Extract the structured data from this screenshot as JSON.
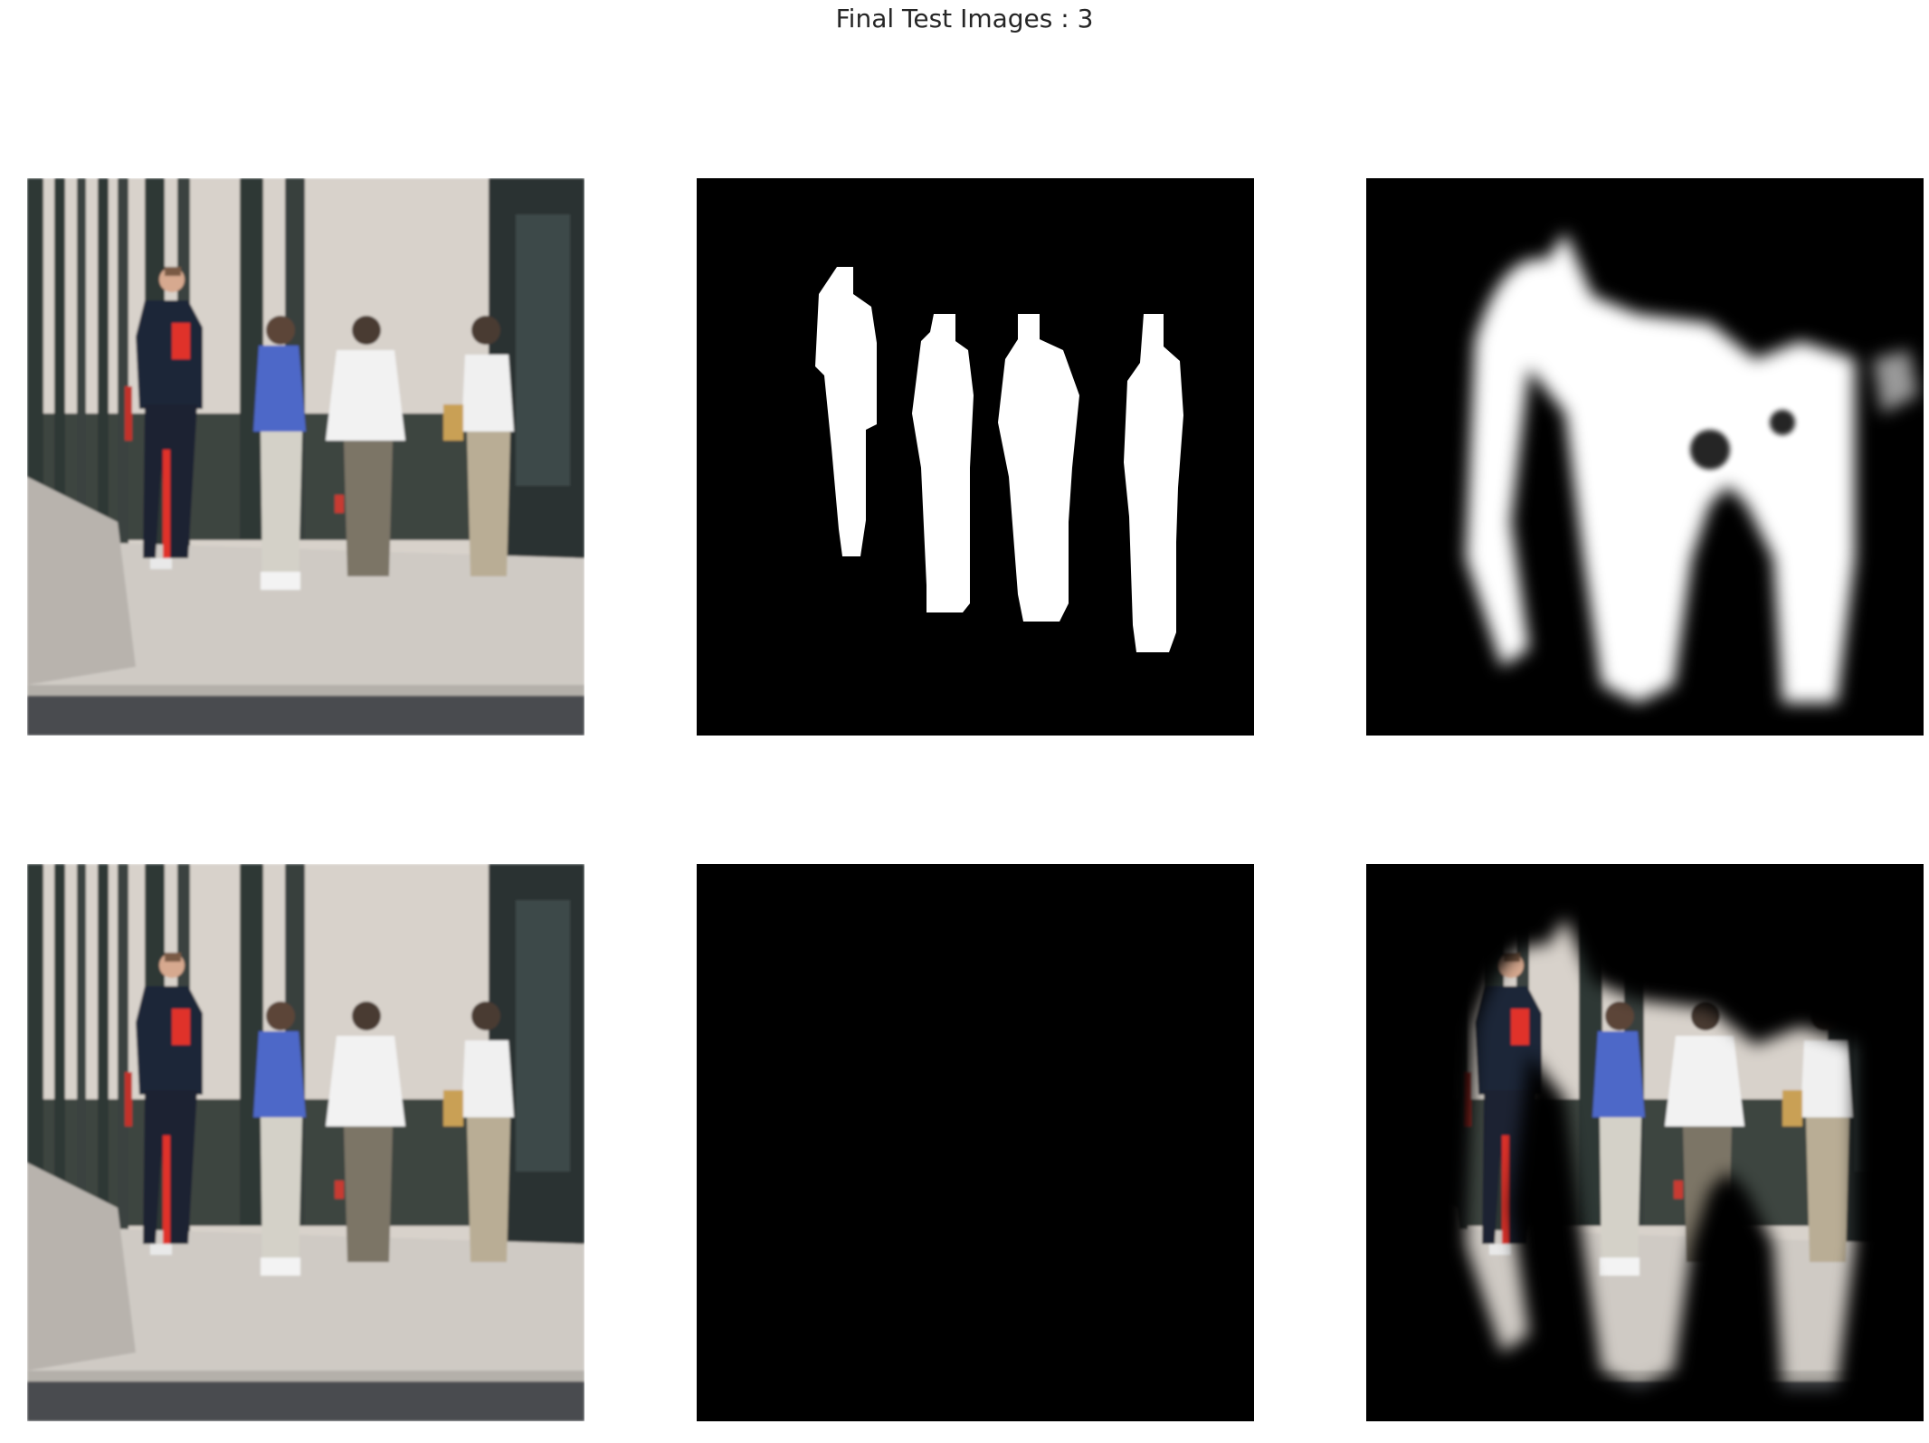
{
  "figure": {
    "title": "Final Test Images : 3"
  },
  "panels": [
    {
      "id": "input-image",
      "kind": "photo"
    },
    {
      "id": "ground-truth-mask",
      "kind": "mask"
    },
    {
      "id": "predicted-mask",
      "kind": "soft-mask"
    },
    {
      "id": "input-image-copy",
      "kind": "photo"
    },
    {
      "id": "ground-truth-masked-image",
      "kind": "masked-photo"
    },
    {
      "id": "predicted-masked-image",
      "kind": "soft-masked-photo"
    }
  ],
  "colors": {
    "background": "#ffffff",
    "title": "#262626",
    "mask_fg": "#ffffff",
    "mask_bg": "#000000",
    "building": "#d8d2cb",
    "pillar": "#2f3835",
    "sidewalk": "#cfcac4",
    "road": "#4a4c50",
    "jacket_navy": "#1d2538",
    "stripe_red": "#e0302a",
    "top_blue": "#4e67c8",
    "shirt_white": "#f2f2f2",
    "pants_khaki": "#b9ad95",
    "pants_gray": "#7b7466"
  }
}
